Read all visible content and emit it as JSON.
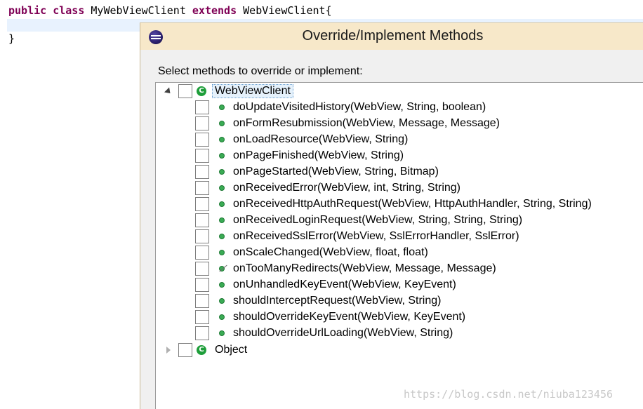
{
  "editor": {
    "line1": {
      "kw1": "public",
      "kw2": "class",
      "name": "MyWebViewClient",
      "kw3": "extends",
      "parent": "WebViewClient{"
    },
    "line3": "}"
  },
  "dialog": {
    "title": "Override/Implement Methods",
    "prompt": "Select methods to override or implement:",
    "root": {
      "label": "WebViewClient",
      "icon": "class-icon",
      "expanded": true
    },
    "methods": [
      "doUpdateVisitedHistory(WebView, String, boolean)",
      "onFormResubmission(WebView, Message, Message)",
      "onLoadResource(WebView, String)",
      "onPageFinished(WebView, String)",
      "onPageStarted(WebView, String, Bitmap)",
      "onReceivedError(WebView, int, String, String)",
      "onReceivedHttpAuthRequest(WebView, HttpAuthHandler, String, String)",
      "onReceivedLoginRequest(WebView, String, String, String)",
      "onReceivedSslError(WebView, SslErrorHandler, SslError)",
      "onScaleChanged(WebView, float, float)",
      "onTooManyRedirects(WebView, Message, Message)",
      "onUnhandledKeyEvent(WebView, KeyEvent)",
      "shouldInterceptRequest(WebView, String)",
      "shouldOverrideKeyEvent(WebView, KeyEvent)",
      "shouldOverrideUrlLoading(WebView, String)"
    ],
    "object": {
      "label": "Object",
      "icon": "class-icon",
      "expanded": false
    }
  },
  "watermark": "https://blog.csdn.net/niuba123456",
  "colors": {
    "keyword": "#7f0055",
    "dialog_bg": "#f7e8c9",
    "method_icon": "#3aab54"
  }
}
